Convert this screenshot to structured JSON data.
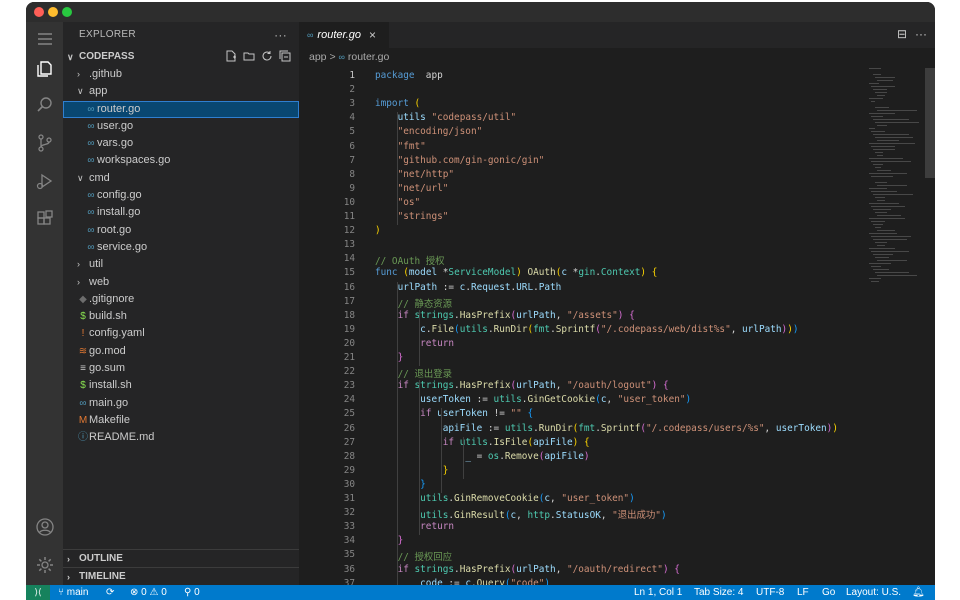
{
  "sidebar": {
    "title": "EXPLORER",
    "more": "···",
    "project": "CODEPASS",
    "outline": "OUTLINE",
    "timeline": "TIMELINE",
    "tree": [
      {
        "name": ".github",
        "type": "folder",
        "open": false,
        "depth": 1
      },
      {
        "name": "app",
        "type": "folder",
        "open": true,
        "depth": 1
      },
      {
        "name": "router.go",
        "type": "go",
        "depth": 2,
        "selected": true
      },
      {
        "name": "user.go",
        "type": "go",
        "depth": 2
      },
      {
        "name": "vars.go",
        "type": "go",
        "depth": 2
      },
      {
        "name": "workspaces.go",
        "type": "go",
        "depth": 2
      },
      {
        "name": "cmd",
        "type": "folder",
        "open": true,
        "depth": 1
      },
      {
        "name": "config.go",
        "type": "go",
        "depth": 2
      },
      {
        "name": "install.go",
        "type": "go",
        "depth": 2
      },
      {
        "name": "root.go",
        "type": "go",
        "depth": 2
      },
      {
        "name": "service.go",
        "type": "go",
        "depth": 2
      },
      {
        "name": "util",
        "type": "folder",
        "open": false,
        "depth": 1
      },
      {
        "name": "web",
        "type": "folder",
        "open": false,
        "depth": 1
      },
      {
        "name": ".gitignore",
        "type": "gitignore",
        "depth": 1
      },
      {
        "name": "build.sh",
        "type": "sh",
        "depth": 1
      },
      {
        "name": "config.yaml",
        "type": "yaml",
        "depth": 1
      },
      {
        "name": "go.mod",
        "type": "mod",
        "depth": 1
      },
      {
        "name": "go.sum",
        "type": "sum",
        "depth": 1
      },
      {
        "name": "install.sh",
        "type": "sh",
        "depth": 1
      },
      {
        "name": "main.go",
        "type": "go",
        "depth": 1
      },
      {
        "name": "Makefile",
        "type": "make",
        "depth": 1
      },
      {
        "name": "README.md",
        "type": "md",
        "depth": 1
      }
    ]
  },
  "editor": {
    "tab": "router.go",
    "tab_close": "×",
    "tab_actions": [
      "⊟",
      "···"
    ],
    "breadcrumb": [
      "app",
      "router.go"
    ],
    "breadcrumb_sep": ">",
    "lines": [
      [
        [
          "kw",
          "package"
        ],
        [
          "",
          "  app"
        ]
      ],
      [],
      [
        [
          "kw",
          "import"
        ],
        [
          "",
          " "
        ],
        [
          "br",
          "("
        ]
      ],
      [
        [
          "",
          "    "
        ],
        [
          "var",
          "utils"
        ],
        [
          "",
          " "
        ],
        [
          "str",
          "\"codepass/util\""
        ]
      ],
      [
        [
          "",
          "    "
        ],
        [
          "str",
          "\"encoding/json\""
        ]
      ],
      [
        [
          "",
          "    "
        ],
        [
          "str",
          "\"fmt\""
        ]
      ],
      [
        [
          "",
          "    "
        ],
        [
          "str",
          "\"github.com/gin-gonic/gin\""
        ]
      ],
      [
        [
          "",
          "    "
        ],
        [
          "str",
          "\"net/http\""
        ]
      ],
      [
        [
          "",
          "    "
        ],
        [
          "str",
          "\"net/url\""
        ]
      ],
      [
        [
          "",
          "    "
        ],
        [
          "str",
          "\"os\""
        ]
      ],
      [
        [
          "",
          "    "
        ],
        [
          "str",
          "\"strings\""
        ]
      ],
      [
        [
          "br",
          ")"
        ]
      ],
      [],
      [
        [
          "cmt",
          "// OAuth 授权"
        ]
      ],
      [
        [
          "kw",
          "func"
        ],
        [
          "",
          " "
        ],
        [
          "br",
          "("
        ],
        [
          "var",
          "model"
        ],
        [
          "",
          " *"
        ],
        [
          "ty",
          "ServiceModel"
        ],
        [
          "br",
          ")"
        ],
        [
          "",
          " "
        ],
        [
          "fn",
          "OAuth"
        ],
        [
          "br",
          "("
        ],
        [
          "var",
          "c"
        ],
        [
          "",
          " *"
        ],
        [
          "ty",
          "gin"
        ],
        [
          "",
          ".",
          ""
        ],
        [
          "ty",
          "Context"
        ],
        [
          "br",
          ")"
        ],
        [
          "",
          " "
        ],
        [
          "br",
          "{"
        ]
      ],
      [
        [
          "",
          "    "
        ],
        [
          "var",
          "urlPath"
        ],
        [
          "",
          " := "
        ],
        [
          "var",
          "c"
        ],
        [
          "",
          "."
        ],
        [
          "var",
          "Request"
        ],
        [
          "",
          "."
        ],
        [
          "var",
          "URL"
        ],
        [
          "",
          "."
        ],
        [
          "var",
          "Path"
        ]
      ],
      [
        [
          "",
          "    "
        ],
        [
          "cmt",
          "// 静态资源"
        ]
      ],
      [
        [
          "",
          "    "
        ],
        [
          "ctl",
          "if"
        ],
        [
          "",
          " "
        ],
        [
          "ty",
          "strings"
        ],
        [
          "",
          "."
        ],
        [
          "fn",
          "HasPrefix"
        ],
        [
          "br2",
          "("
        ],
        [
          "var",
          "urlPath"
        ],
        [
          "",
          ", "
        ],
        [
          "str",
          "\"/assets\""
        ],
        [
          "br2",
          ")"
        ],
        [
          "",
          " "
        ],
        [
          "br2",
          "{"
        ]
      ],
      [
        [
          "",
          "        "
        ],
        [
          "var",
          "c"
        ],
        [
          "",
          "."
        ],
        [
          "fn",
          "File"
        ],
        [
          "br3",
          "("
        ],
        [
          "ty",
          "utils"
        ],
        [
          "",
          "."
        ],
        [
          "fn",
          "RunDir"
        ],
        [
          "br",
          "("
        ],
        [
          "ty",
          "fmt"
        ],
        [
          "",
          "."
        ],
        [
          "fn",
          "Sprintf"
        ],
        [
          "br2",
          "("
        ],
        [
          "str",
          "\"/.codepass/web/dist%s\""
        ],
        [
          "",
          ", "
        ],
        [
          "var",
          "urlPath"
        ],
        [
          "br2",
          ")"
        ],
        [
          "br",
          ")"
        ],
        [
          "br3",
          ")"
        ]
      ],
      [
        [
          "",
          "        "
        ],
        [
          "ctl",
          "return"
        ]
      ],
      [
        [
          "",
          "    "
        ],
        [
          "br2",
          "}"
        ]
      ],
      [
        [
          "",
          "    "
        ],
        [
          "cmt",
          "// 退出登录"
        ]
      ],
      [
        [
          "",
          "    "
        ],
        [
          "ctl",
          "if"
        ],
        [
          "",
          " "
        ],
        [
          "ty",
          "strings"
        ],
        [
          "",
          "."
        ],
        [
          "fn",
          "HasPrefix"
        ],
        [
          "br2",
          "("
        ],
        [
          "var",
          "urlPath"
        ],
        [
          "",
          ", "
        ],
        [
          "str",
          "\"/oauth/logout\""
        ],
        [
          "br2",
          ")"
        ],
        [
          "",
          " "
        ],
        [
          "br2",
          "{"
        ]
      ],
      [
        [
          "",
          "        "
        ],
        [
          "var",
          "userToken"
        ],
        [
          "",
          " := "
        ],
        [
          "ty",
          "utils"
        ],
        [
          "",
          "."
        ],
        [
          "fn",
          "GinGetCookie"
        ],
        [
          "br3",
          "("
        ],
        [
          "var",
          "c"
        ],
        [
          "",
          ", "
        ],
        [
          "str",
          "\"user_token\""
        ],
        [
          "br3",
          ")"
        ]
      ],
      [
        [
          "",
          "        "
        ],
        [
          "ctl",
          "if"
        ],
        [
          "",
          " "
        ],
        [
          "var",
          "userToken"
        ],
        [
          "",
          " != "
        ],
        [
          "str",
          "\"\""
        ],
        [
          "",
          " "
        ],
        [
          "br3",
          "{"
        ]
      ],
      [
        [
          "",
          "            "
        ],
        [
          "var",
          "apiFile"
        ],
        [
          "",
          " := "
        ],
        [
          "ty",
          "utils"
        ],
        [
          "",
          "."
        ],
        [
          "fn",
          "RunDir"
        ],
        [
          "br",
          "("
        ],
        [
          "ty",
          "fmt"
        ],
        [
          "",
          "."
        ],
        [
          "fn",
          "Sprintf"
        ],
        [
          "br2",
          "("
        ],
        [
          "str",
          "\"/.codepass/users/%s\""
        ],
        [
          "",
          ", "
        ],
        [
          "var",
          "userToken"
        ],
        [
          "br2",
          ")"
        ],
        [
          "br",
          ")"
        ]
      ],
      [
        [
          "",
          "            "
        ],
        [
          "ctl",
          "if"
        ],
        [
          "",
          " "
        ],
        [
          "ty",
          "utils"
        ],
        [
          "",
          "."
        ],
        [
          "fn",
          "IsFile"
        ],
        [
          "br",
          "("
        ],
        [
          "var",
          "apiFile"
        ],
        [
          "br",
          ")"
        ],
        [
          "",
          " "
        ],
        [
          "br",
          "{"
        ]
      ],
      [
        [
          "",
          "                "
        ],
        [
          "var",
          "_"
        ],
        [
          "",
          " = "
        ],
        [
          "ty",
          "os"
        ],
        [
          "",
          "."
        ],
        [
          "fn",
          "Remove"
        ],
        [
          "br2",
          "("
        ],
        [
          "var",
          "apiFile"
        ],
        [
          "br2",
          ")"
        ]
      ],
      [
        [
          "",
          "            "
        ],
        [
          "br",
          "}"
        ]
      ],
      [
        [
          "",
          "        "
        ],
        [
          "br3",
          "}"
        ]
      ],
      [
        [
          "",
          "        "
        ],
        [
          "ty",
          "utils"
        ],
        [
          "",
          "."
        ],
        [
          "fn",
          "GinRemoveCookie"
        ],
        [
          "br3",
          "("
        ],
        [
          "var",
          "c"
        ],
        [
          "",
          ", "
        ],
        [
          "str",
          "\"user_token\""
        ],
        [
          "br3",
          ")"
        ]
      ],
      [
        [
          "",
          "        "
        ],
        [
          "ty",
          "utils"
        ],
        [
          "",
          "."
        ],
        [
          "fn",
          "GinResult"
        ],
        [
          "br3",
          "("
        ],
        [
          "var",
          "c"
        ],
        [
          "",
          ", "
        ],
        [
          "ty",
          "http"
        ],
        [
          "",
          "."
        ],
        [
          "var",
          "StatusOK"
        ],
        [
          "",
          ", "
        ],
        [
          "str",
          "\"退出成功\""
        ],
        [
          "br3",
          ")"
        ]
      ],
      [
        [
          "",
          "        "
        ],
        [
          "ctl",
          "return"
        ]
      ],
      [
        [
          "",
          "    "
        ],
        [
          "br2",
          "}"
        ]
      ],
      [
        [
          "",
          "    "
        ],
        [
          "cmt",
          "// 授权回应"
        ]
      ],
      [
        [
          "",
          "    "
        ],
        [
          "ctl",
          "if"
        ],
        [
          "",
          " "
        ],
        [
          "ty",
          "strings"
        ],
        [
          "",
          "."
        ],
        [
          "fn",
          "HasPrefix"
        ],
        [
          "br2",
          "("
        ],
        [
          "var",
          "urlPath"
        ],
        [
          "",
          ", "
        ],
        [
          "str",
          "\"/oauth/redirect\""
        ],
        [
          "br2",
          ")"
        ],
        [
          "",
          " "
        ],
        [
          "br2",
          "{"
        ]
      ],
      [
        [
          "",
          "        "
        ],
        [
          "var",
          "code"
        ],
        [
          "",
          " := "
        ],
        [
          "var",
          "c"
        ],
        [
          "",
          "."
        ],
        [
          "fn",
          "Query"
        ],
        [
          "br3",
          "("
        ],
        [
          "str",
          "\"code\""
        ],
        [
          "br3",
          ")"
        ]
      ]
    ]
  },
  "status": {
    "branch": "main",
    "errors": "0",
    "warnings": "0",
    "ports": "0",
    "position": "Ln 1, Col 1",
    "tab_size": "Tab Size: 4",
    "encoding": "UTF-8",
    "eol": "LF",
    "language": "Go",
    "layout": "Layout: U.S."
  },
  "colors": {
    "accent": "#007acc",
    "go_icon": "#519aba",
    "selection": "#094771"
  }
}
